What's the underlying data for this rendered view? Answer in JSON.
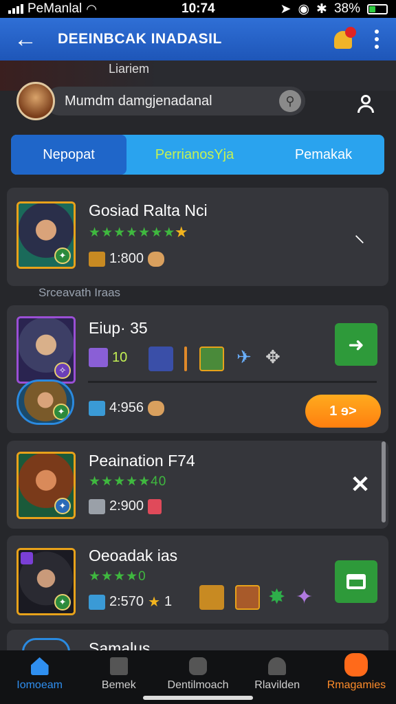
{
  "status_bar": {
    "carrier": "PeManlal",
    "time": "10:74",
    "battery": "38%",
    "battery_level": 0.38
  },
  "header": {
    "title": "DEEINBCAK INADASIL"
  },
  "hero_label": "Liariem",
  "search": {
    "value": "Mumdm damgjenadanal"
  },
  "tabs": [
    {
      "label": "Nepopat"
    },
    {
      "label": "PerrianosYja"
    },
    {
      "label": "Pemakak"
    }
  ],
  "section_label": "Srceavath Iraas",
  "cards": [
    {
      "name": "Gosiad Ralta Nci",
      "stars": "★★★★★★★",
      "star_gold": "★",
      "resource": "1:800",
      "action_icon": "hammer-icon"
    },
    {
      "name": "Eiup· 35",
      "level": "10",
      "resource": "4:956",
      "button_label": "1 ɘ>",
      "action_icon": "share-icon"
    },
    {
      "name": "Peaination F74",
      "stars": "★★★★★40",
      "resource": "2:900",
      "action_icon": "close-icon",
      "action_glyph": "✕"
    },
    {
      "name": "Oeoadak ias",
      "stars": "★★★★0",
      "resource": "2:570",
      "rank": "1",
      "action_icon": "window-icon"
    },
    {
      "name": "Samalus"
    }
  ],
  "bottom_nav": [
    {
      "label": "Iomoeam",
      "icon": "home-icon"
    },
    {
      "label": "Bemek",
      "icon": "question-icon"
    },
    {
      "label": "Dentilmoach",
      "icon": "map-icon"
    },
    {
      "label": "Rlavilden",
      "icon": "profile-icon"
    },
    {
      "label": "Rmagamies",
      "icon": "games-icon"
    }
  ],
  "colors": {
    "accent": "#2f6fd6",
    "active_tab": "#1f66c9",
    "tab_bar": "#2aa3ee",
    "green": "#2e9a3a",
    "orange": "#ff8c1a",
    "card_bg": "#35363b"
  }
}
